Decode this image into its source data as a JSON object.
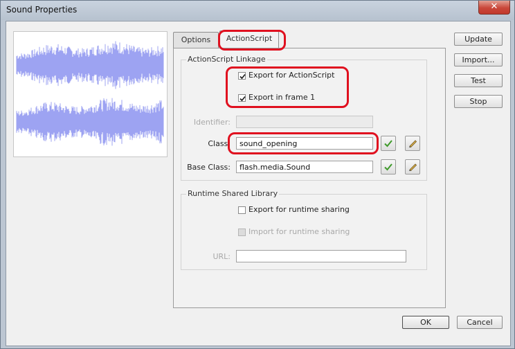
{
  "window": {
    "title": "Sound Properties",
    "close_glyph": "✕"
  },
  "tabs": [
    {
      "label": "Options",
      "active": false
    },
    {
      "label": "ActionScript",
      "active": true
    }
  ],
  "linkage": {
    "group_title": "ActionScript Linkage",
    "export_actionscript": {
      "label": "Export for ActionScript",
      "checked": true
    },
    "export_frame1": {
      "label": "Export in frame 1",
      "checked": true
    },
    "identifier_label": "Identifier:",
    "identifier_value": "",
    "class_label": "Class:",
    "class_value": "sound_opening",
    "base_class_label": "Base Class:",
    "base_class_value": "flash.media.Sound"
  },
  "rsl": {
    "group_title": "Runtime Shared Library",
    "export_runtime": {
      "label": "Export for runtime sharing",
      "checked": false
    },
    "import_runtime": {
      "label": "Import for runtime sharing",
      "checked": false,
      "disabled": true
    },
    "url_label": "URL:",
    "url_value": ""
  },
  "side_buttons": [
    "Update",
    "Import...",
    "Test",
    "Stop"
  ],
  "footer": {
    "ok": "OK",
    "cancel": "Cancel"
  },
  "colors": {
    "highlight": "#e0101f",
    "waveform": "#9da3f2",
    "check": "#3f9a2a"
  },
  "icons": [
    "close-icon",
    "waveform",
    "checkbox-checked-icon",
    "validate-check-icon",
    "edit-pencil-icon"
  ]
}
